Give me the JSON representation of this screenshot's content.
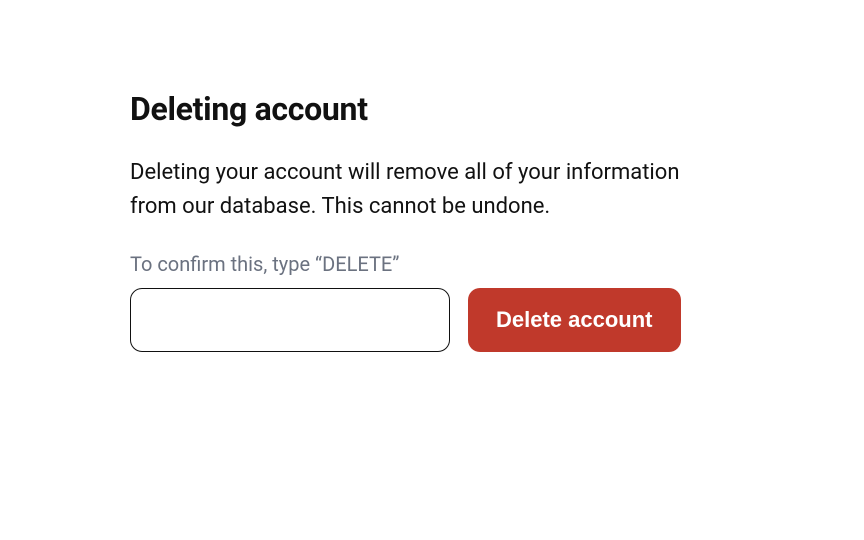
{
  "heading": "Deleting account",
  "description": "Deleting your account will remove all of your information from our database. This cannot be undone.",
  "confirm": {
    "label": "To confirm this, type “DELETE”",
    "value": ""
  },
  "button": {
    "label": "Delete account"
  },
  "colors": {
    "danger": "#c0392b"
  }
}
